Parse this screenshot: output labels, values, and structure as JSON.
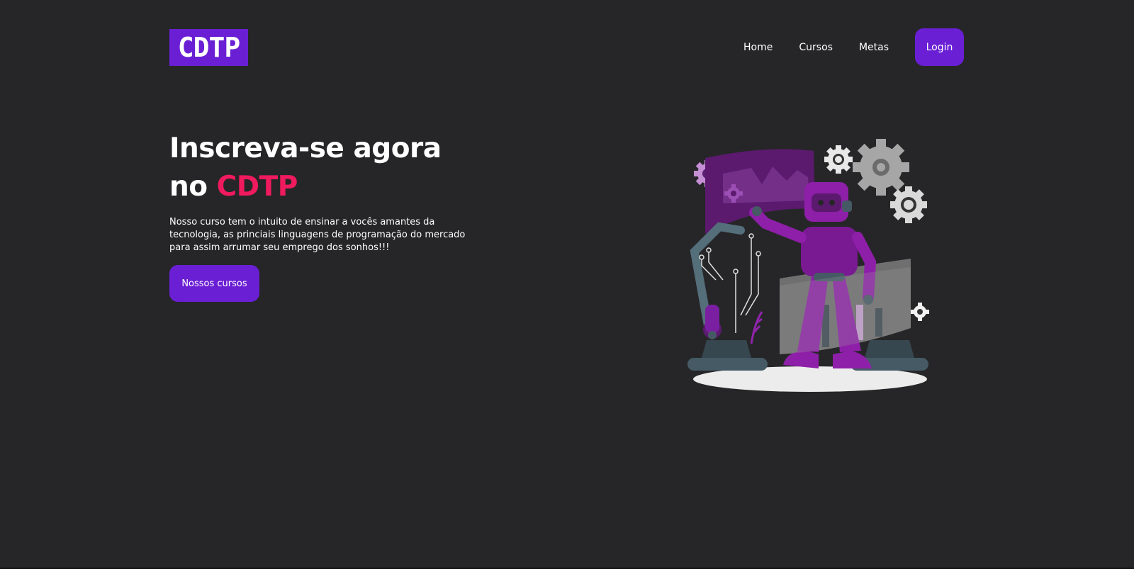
{
  "header": {
    "logo_text": "CDTP",
    "nav": [
      {
        "label": "Home"
      },
      {
        "label": "Cursos"
      },
      {
        "label": "Metas"
      }
    ],
    "login_label": "Login"
  },
  "hero": {
    "title_line1": "Inscreva-se agora",
    "title_line2_prefix": "no",
    "title_line2_accent": "CDTP",
    "description": "Nosso curso tem o intuito de ensinar a vocês amantes da tecnologia, as princiais linguagens de programação do mercado para assim arrumar seu emprego dos sonhos!!!",
    "cta_label": "Nossos cursos"
  },
  "colors": {
    "background": "#262628",
    "brand": "#6a1fd4",
    "accent": "#f01a5e"
  },
  "illustration": {
    "icon": "robot-programming-illustration"
  }
}
